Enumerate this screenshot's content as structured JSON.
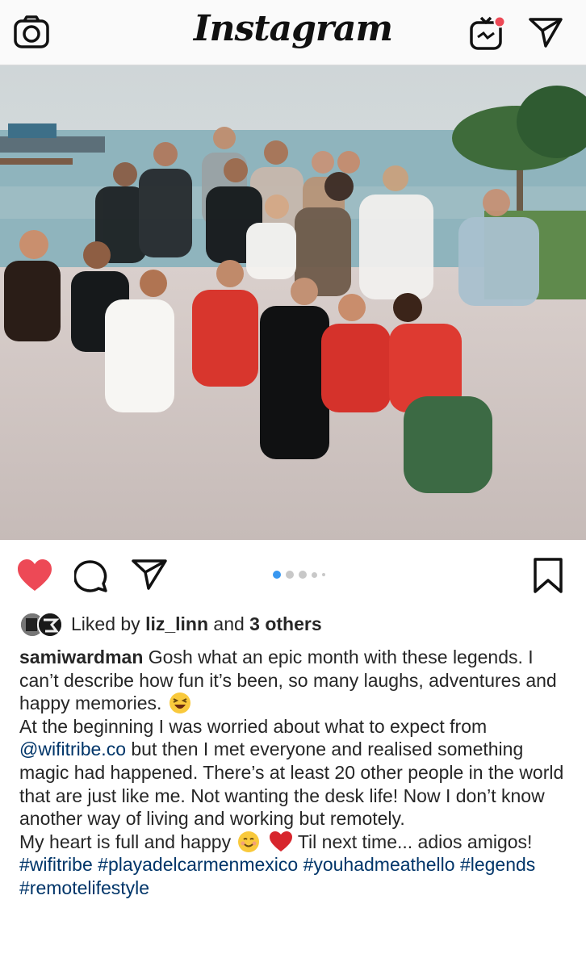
{
  "header": {
    "logo_text": "Instagram",
    "camera_icon": "camera-icon",
    "igtv_icon": "igtv-icon",
    "direct_icon": "direct-message-icon",
    "notification_color": "#ed4956"
  },
  "post": {
    "image_icon": "group-photo-image",
    "carousel": {
      "total_dots": 5,
      "active_index": 0,
      "active_color": "#3897f0"
    },
    "actions": {
      "like_icon": "heart-filled-icon",
      "like_color": "#ed4956",
      "comment_icon": "comment-icon",
      "share_icon": "share-icon",
      "save_icon": "bookmark-icon"
    },
    "likes": {
      "prefix": "Liked by",
      "user": "liz_linn",
      "connector": "and",
      "others": "3 others"
    },
    "caption": {
      "username": "samiwardman",
      "line1": "Gosh what an epic month with these legends. I can’t describe how fun it’s been, so many laughs, adventures and happy memories.",
      "line2_before": "At the beginning I was worried about what to expect from",
      "mention": "@wifitribe.co",
      "line2_after": "but then I met everyone and realised something magic had happened. There’s at least 20 other people in the world that are just like me. Not wanting the desk life! Now I don’t know another way of living and working but remotely.",
      "line3_before": "My heart is full and happy",
      "line3_after": "Til next time... adios amigos!",
      "hashtags": [
        "#wifitribe",
        "#playadelcarmenmexico",
        "#youhadmeathello",
        "#legends",
        "#remotelifestyle"
      ]
    }
  }
}
